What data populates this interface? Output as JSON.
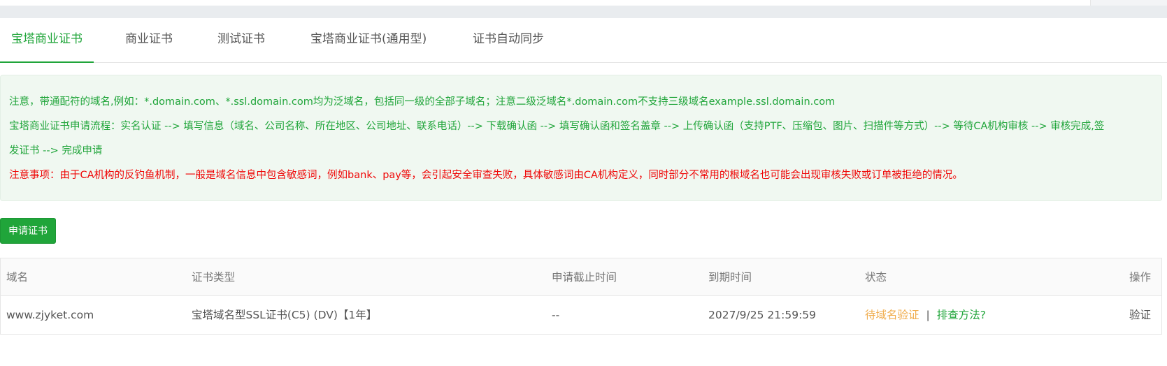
{
  "tabs": [
    {
      "label": "宝塔商业证书",
      "active": true
    },
    {
      "label": "商业证书",
      "active": false
    },
    {
      "label": "测试证书",
      "active": false
    },
    {
      "label": "宝塔商业证书(通用型)",
      "active": false
    },
    {
      "label": "证书自动同步",
      "active": false
    }
  ],
  "notice": {
    "line1": "注意，带通配符的域名,例如：*.domain.com、*.ssl.domain.com均为泛域名，包括同一级的全部子域名；注意二级泛域名*.domain.com不支持三级域名example.ssl.domain.com",
    "line2": "宝塔商业证书申请流程：实名认证 --> 填写信息（域名、公司名称、所在地区、公司地址、联系电话）--> 下载确认函 --> 填写确认函和签名盖章 --> 上传确认函（支持PTF、压缩包、图片、扫描件等方式）--> 等待CA机构审核 --> 审核完成,签",
    "line3": "发证书 --> 完成申请",
    "warning": "注意事项：由于CA机构的反钓鱼机制，一般是域名信息中包含敏感词，例如bank、pay等，会引起安全审查失败，具体敏感词由CA机构定义，同时部分不常用的根域名也可能会出现审核失败或订单被拒绝的情况。"
  },
  "apply_button": "申请证书",
  "table": {
    "headers": [
      "域名",
      "证书类型",
      "申请截止时间",
      "到期时间",
      "状态",
      "操作"
    ],
    "rows": [
      {
        "domain": "www.zjyket.com",
        "type": "宝塔域名型SSL证书(C5) (DV)【1年】",
        "deadline": "--",
        "expiry": "2027/9/25 21:59:59",
        "status": "待域名验证",
        "separator": "|",
        "troubleshoot": "排查方法?",
        "action": "验证"
      }
    ]
  },
  "colors": {
    "accent": "#20a53a",
    "warning": "#ef0808",
    "pending": "#f0ad4e"
  }
}
